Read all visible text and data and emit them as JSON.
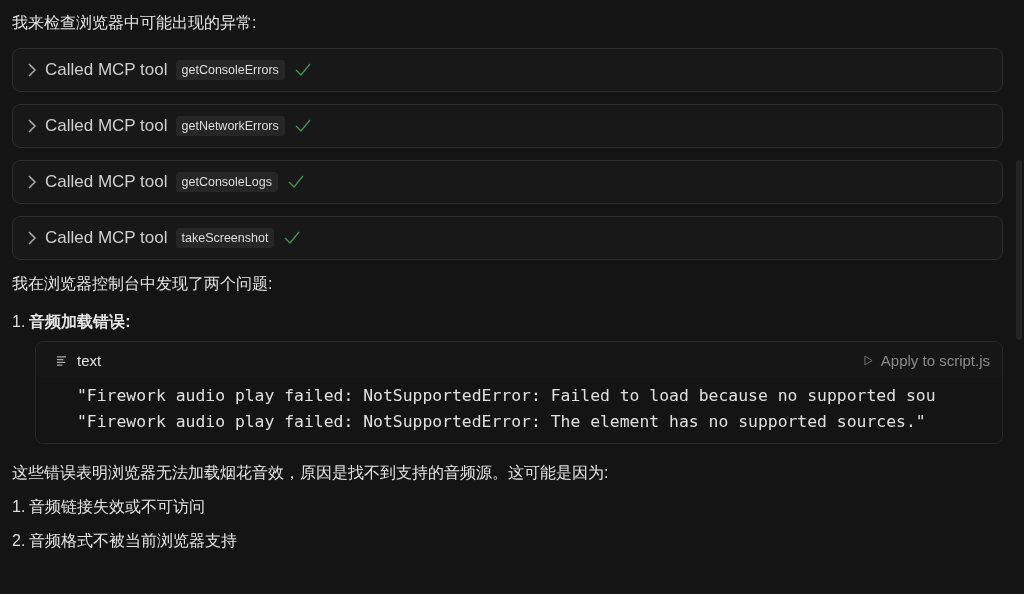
{
  "intro": "我来检查浏览器中可能出现的异常:",
  "tool_calls": [
    {
      "label": "Called MCP tool",
      "tool": "getConsoleErrors",
      "expanded": false
    },
    {
      "label": "Called MCP tool",
      "tool": "getNetworkErrors",
      "expanded": false
    },
    {
      "label": "Called MCP tool",
      "tool": "getConsoleLogs",
      "expanded": false
    },
    {
      "label": "Called MCP tool",
      "tool": "takeScreenshot",
      "expanded": false
    }
  ],
  "findings_heading": "我在浏览器控制台中发现了两个问题:",
  "issues": [
    {
      "number": "1.",
      "title": "音频加载错误:",
      "code_block": {
        "language": "text",
        "apply": "Apply to script.js",
        "lines": [
          "\"Firework audio play failed: NotSupportedError: Failed to load because no supported sou",
          "\"Firework audio play failed: NotSupportedError: The element has no supported sources.\""
        ]
      }
    }
  ],
  "explanation": "这些错误表明浏览器无法加载烟花音效，原因是找不到支持的音频源。这可能是因为:",
  "causes": [
    {
      "number": "1.",
      "text": "音频链接失效或不可访问"
    },
    {
      "number": "2.",
      "text": "音频格式不被当前浏览器支持"
    }
  ]
}
